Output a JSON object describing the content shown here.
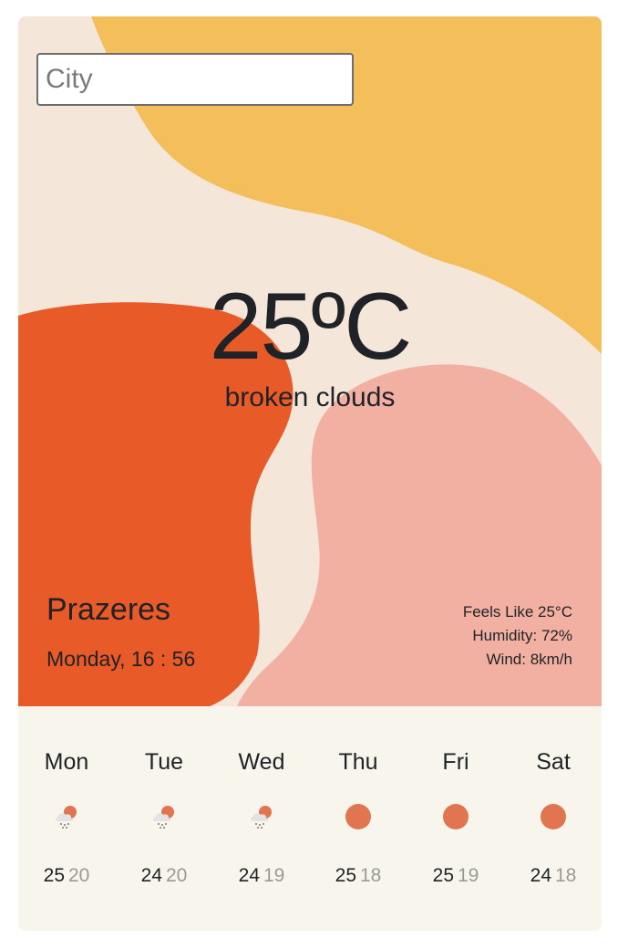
{
  "search": {
    "placeholder": "City",
    "value": ""
  },
  "current": {
    "temperature": "25ºC",
    "description": "broken clouds",
    "location": "Prazeres",
    "datetime": "Monday, 16 : 56",
    "feels_like": "Feels Like 25°C",
    "humidity": "Humidity: 72%",
    "wind": "Wind: 8km/h"
  },
  "forecast": [
    {
      "day": "Mon",
      "icon": "rain-cloud-sun-icon",
      "high": "25",
      "low": "20"
    },
    {
      "day": "Tue",
      "icon": "rain-cloud-sun-icon",
      "high": "24",
      "low": "20"
    },
    {
      "day": "Wed",
      "icon": "rain-cloud-sun-icon",
      "high": "24",
      "low": "19"
    },
    {
      "day": "Thu",
      "icon": "sun-icon",
      "high": "25",
      "low": "18"
    },
    {
      "day": "Fri",
      "icon": "sun-icon",
      "high": "25",
      "low": "19"
    },
    {
      "day": "Sat",
      "icon": "sun-icon",
      "high": "24",
      "low": "18"
    }
  ],
  "colors": {
    "background_cream": "#f4e6d9",
    "blob_yellow": "#f4be5a",
    "blob_orange": "#e85a28",
    "blob_pink": "#f2b0a2",
    "forecast_bg": "#f8f6ec",
    "sun": "#e07550"
  }
}
